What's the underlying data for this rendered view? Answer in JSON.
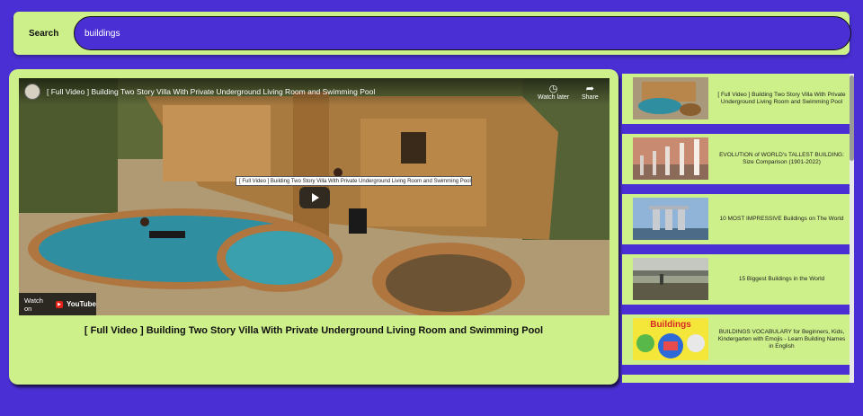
{
  "search": {
    "label": "Search",
    "value": "buildings"
  },
  "player": {
    "overlay_title": "[ Full Video ] Building Two Story Villa With Private Underground Living Room and Swimming Pool",
    "watch_later_label": "Watch later",
    "share_label": "Share",
    "tooltip_text": "[ Full Video ] Building Two Story Villa With Private Underground Living Room and Swimming Pool",
    "watch_on_label": "Watch on",
    "youtube_label": "YouTube",
    "caption": "[ Full Video ] Building Two Story Villa With Private Underground Living Room and Swimming Pool"
  },
  "recommendations": [
    {
      "title": "[ Full Video ] Building Two Story Villa With Private Underground Living Room and Swimming Pool"
    },
    {
      "title": "EVOLUTION of WORLD's TALLEST BUILDING: Size Comparison (1901-2022)"
    },
    {
      "title": "10 MOST IMPRESSIVE Buildings on The World"
    },
    {
      "title": "15 Biggest Buildings in the World"
    },
    {
      "title": "BUILDINGS VOCABULARY for Beginners, Kids, Kindergarten with Emojis - Learn Building Names in English",
      "thumb_text": "Buildings"
    }
  ],
  "colors": {
    "background": "#4a30d4",
    "panel": "#cdf08a"
  }
}
